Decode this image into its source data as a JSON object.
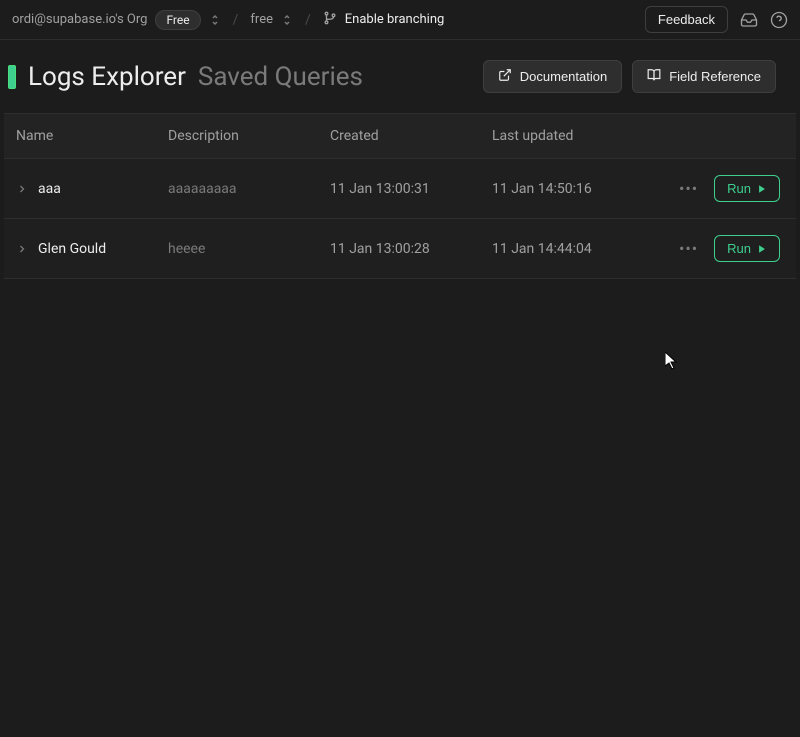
{
  "topbar": {
    "org": "ordi@supabase.io's Org",
    "plan": "Free",
    "project": "free",
    "branch_label": "Enable branching",
    "feedback_label": "Feedback"
  },
  "header": {
    "title": "Logs Explorer",
    "subtitle": "Saved Queries",
    "documentation_label": "Documentation",
    "field_reference_label": "Field Reference"
  },
  "table": {
    "columns": {
      "name": "Name",
      "description": "Description",
      "created": "Created",
      "updated": "Last updated"
    },
    "rows": [
      {
        "name": "aaa",
        "description": "aaaaaaaaa",
        "created": "11 Jan 13:00:31",
        "updated": "11 Jan 14:50:16",
        "run_label": "Run"
      },
      {
        "name": "Glen Gould",
        "description": "heeee",
        "created": "11 Jan 13:00:28",
        "updated": "11 Jan 14:44:04",
        "run_label": "Run"
      }
    ]
  }
}
